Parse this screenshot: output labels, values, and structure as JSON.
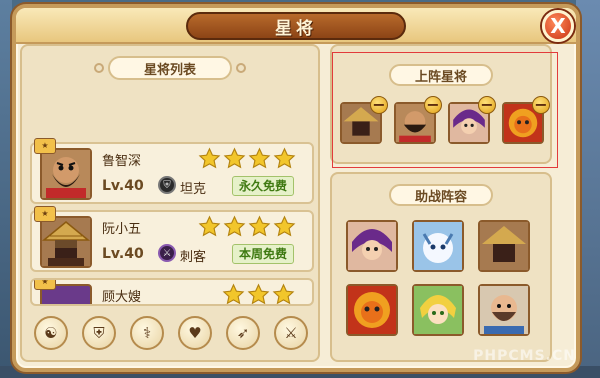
{
  "title": "星将",
  "close_label": "X",
  "left_panel": {
    "header": "星将列表",
    "heroes": [
      {
        "name": "鲁智深",
        "level": "Lv.40",
        "role": "坦克",
        "free": "永久免费",
        "stars": 4
      },
      {
        "name": "阮小五",
        "level": "Lv.40",
        "role": "刺客",
        "free": "本周免费",
        "stars": 4
      },
      {
        "name": "顾大嫂",
        "level": "",
        "role": "",
        "free": "",
        "stars": 3
      }
    ],
    "filters": [
      "yin-yang",
      "shield",
      "staff",
      "heart",
      "bow",
      "sword"
    ]
  },
  "lineup": {
    "header": "上阵星将",
    "slots": [
      {
        "hero": "straw-hat-hero"
      },
      {
        "hero": "dark-face-hero"
      },
      {
        "hero": "purple-hair-hero"
      },
      {
        "hero": "lion-mask-hero"
      }
    ]
  },
  "support": {
    "header": "助战阵容",
    "slots": [
      {
        "hero": "purple-hair-hero"
      },
      {
        "hero": "white-dragon-hero"
      },
      {
        "hero": "straw-hat-hero"
      },
      {
        "hero": "lion-mask-hero"
      },
      {
        "hero": "blonde-hero"
      },
      {
        "hero": "bearded-hero"
      }
    ]
  },
  "watermark": "PHPCMS.CN",
  "colors": {
    "frame": "#c59a5a",
    "panel_bg": "#efe2c3",
    "title_plate": "#b86a2b",
    "star": "#f2c62b",
    "free_tag_text": "#3f7a12",
    "highlight": "#e23b3b"
  }
}
